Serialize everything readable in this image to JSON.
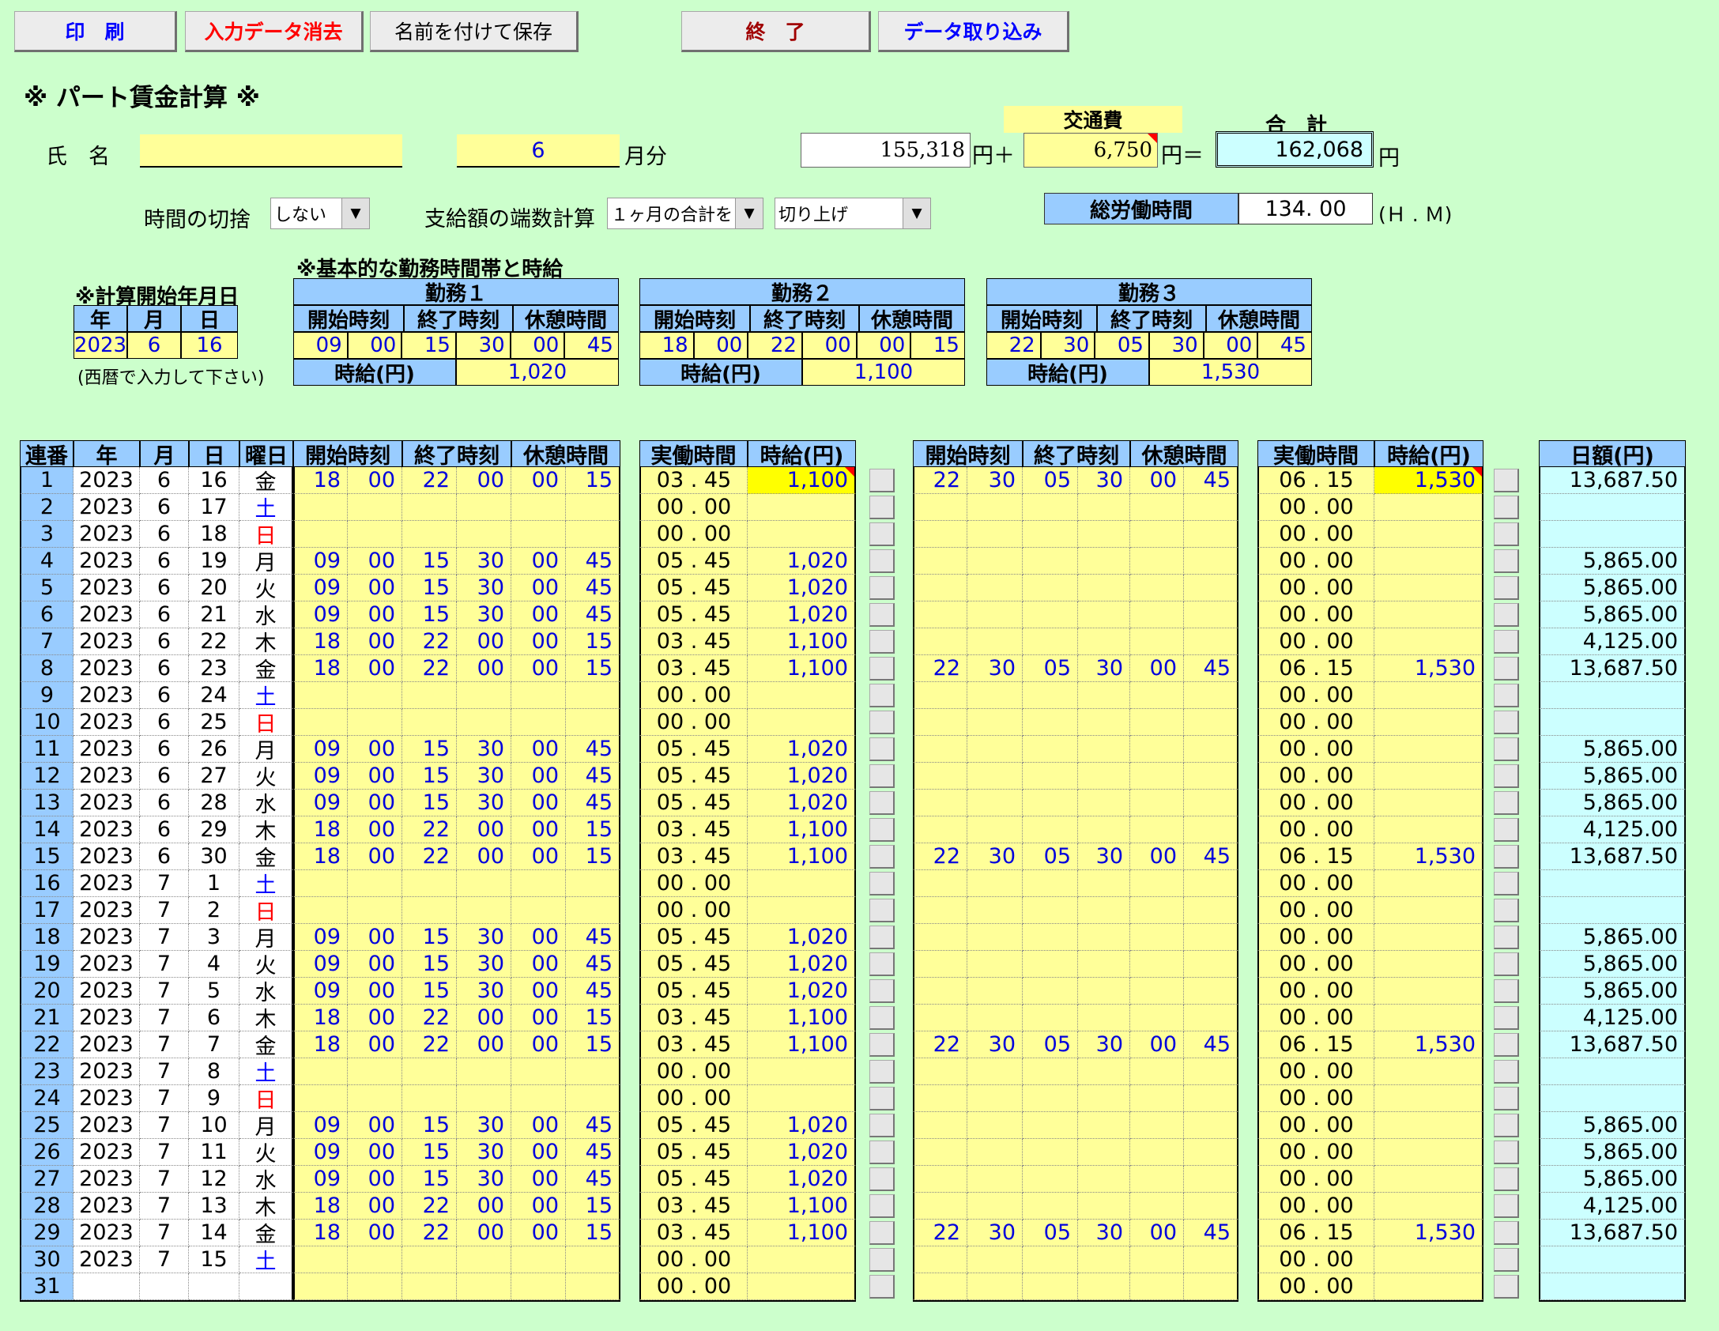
{
  "toolbar": {
    "print": "印　刷",
    "clear": "入力データ消去",
    "save_as": "名前を付けて保存",
    "exit": "終　了",
    "import": "データ取り込み"
  },
  "title": "※ パート賃金計算 ※",
  "name_row": {
    "name_label": "氏　名",
    "name_value": "",
    "month_value": "6",
    "month_suffix": "月分",
    "pay_value": "155,318",
    "yen_plus": "円＋",
    "transport_label": "交通費",
    "transport_value": "6,750",
    "yen_eq": "円＝",
    "total_label": "合　計",
    "total_value": "162,068",
    "yen": "円"
  },
  "options": {
    "rounding_label": "時間の切捨",
    "rounding_value": "しない",
    "pay_round_label": "支給額の端数計算",
    "pay_round_mode": "１ヶ月の合計を",
    "pay_round_value": "切り上げ",
    "total_hours_label": "総労働時間",
    "total_hours_value": "134. 00",
    "hm_label": "(Ｈ . Ｍ)"
  },
  "start": {
    "heading": "※計算開始年月日",
    "headers": [
      "年",
      "月",
      "日"
    ],
    "values": [
      "2023",
      "6",
      "16"
    ],
    "note": "(西暦で入力して下さい)"
  },
  "shift_ref": {
    "heading": "※基本的な勤務時間帯と時給",
    "col_headers": [
      "開始時刻",
      "終了時刻",
      "休憩時間"
    ],
    "wage_label": "時給(円)",
    "shifts": [
      {
        "name": "勤務１",
        "times": [
          "09",
          "00",
          "15",
          "30",
          "00",
          "45"
        ],
        "wage": "1,020"
      },
      {
        "name": "勤務２",
        "times": [
          "18",
          "00",
          "22",
          "00",
          "00",
          "15"
        ],
        "wage": "1,100"
      },
      {
        "name": "勤務３",
        "times": [
          "22",
          "30",
          "05",
          "30",
          "00",
          "45"
        ],
        "wage": "1,530"
      }
    ]
  },
  "table": {
    "headers": {
      "no": "連番",
      "year": "年",
      "month": "月",
      "day": "日",
      "dow": "曜日",
      "start": "開始時刻",
      "end": "終了時刻",
      "break": "休憩時間",
      "actual": "実働時間",
      "wage": "時給(円)",
      "daily": "日額(円)"
    },
    "rows": [
      [
        "1",
        "2023",
        "6",
        "16",
        "金",
        "18",
        "00",
        "22",
        "00",
        "00",
        "15",
        "03 . 45",
        "1,100",
        "22",
        "30",
        "05",
        "30",
        "00",
        "45",
        "06 . 15",
        "1,530",
        "13,687.50"
      ],
      [
        "2",
        "2023",
        "6",
        "17",
        "土",
        "",
        "",
        "",
        "",
        "",
        "",
        "00 . 00",
        "",
        "",
        "",
        "",
        "",
        "",
        "",
        "00 . 00",
        "",
        ""
      ],
      [
        "3",
        "2023",
        "6",
        "18",
        "日",
        "",
        "",
        "",
        "",
        "",
        "",
        "00 . 00",
        "",
        "",
        "",
        "",
        "",
        "",
        "",
        "00 . 00",
        "",
        ""
      ],
      [
        "4",
        "2023",
        "6",
        "19",
        "月",
        "09",
        "00",
        "15",
        "30",
        "00",
        "45",
        "05 . 45",
        "1,020",
        "",
        "",
        "",
        "",
        "",
        "",
        "00 . 00",
        "",
        "5,865.00"
      ],
      [
        "5",
        "2023",
        "6",
        "20",
        "火",
        "09",
        "00",
        "15",
        "30",
        "00",
        "45",
        "05 . 45",
        "1,020",
        "",
        "",
        "",
        "",
        "",
        "",
        "00 . 00",
        "",
        "5,865.00"
      ],
      [
        "6",
        "2023",
        "6",
        "21",
        "水",
        "09",
        "00",
        "15",
        "30",
        "00",
        "45",
        "05 . 45",
        "1,020",
        "",
        "",
        "",
        "",
        "",
        "",
        "00 . 00",
        "",
        "5,865.00"
      ],
      [
        "7",
        "2023",
        "6",
        "22",
        "木",
        "18",
        "00",
        "22",
        "00",
        "00",
        "15",
        "03 . 45",
        "1,100",
        "",
        "",
        "",
        "",
        "",
        "",
        "00 . 00",
        "",
        "4,125.00"
      ],
      [
        "8",
        "2023",
        "6",
        "23",
        "金",
        "18",
        "00",
        "22",
        "00",
        "00",
        "15",
        "03 . 45",
        "1,100",
        "22",
        "30",
        "05",
        "30",
        "00",
        "45",
        "06 . 15",
        "1,530",
        "13,687.50"
      ],
      [
        "9",
        "2023",
        "6",
        "24",
        "土",
        "",
        "",
        "",
        "",
        "",
        "",
        "00 . 00",
        "",
        "",
        "",
        "",
        "",
        "",
        "",
        "00 . 00",
        "",
        ""
      ],
      [
        "10",
        "2023",
        "6",
        "25",
        "日",
        "",
        "",
        "",
        "",
        "",
        "",
        "00 . 00",
        "",
        "",
        "",
        "",
        "",
        "",
        "",
        "00 . 00",
        "",
        ""
      ],
      [
        "11",
        "2023",
        "6",
        "26",
        "月",
        "09",
        "00",
        "15",
        "30",
        "00",
        "45",
        "05 . 45",
        "1,020",
        "",
        "",
        "",
        "",
        "",
        "",
        "00 . 00",
        "",
        "5,865.00"
      ],
      [
        "12",
        "2023",
        "6",
        "27",
        "火",
        "09",
        "00",
        "15",
        "30",
        "00",
        "45",
        "05 . 45",
        "1,020",
        "",
        "",
        "",
        "",
        "",
        "",
        "00 . 00",
        "",
        "5,865.00"
      ],
      [
        "13",
        "2023",
        "6",
        "28",
        "水",
        "09",
        "00",
        "15",
        "30",
        "00",
        "45",
        "05 . 45",
        "1,020",
        "",
        "",
        "",
        "",
        "",
        "",
        "00 . 00",
        "",
        "5,865.00"
      ],
      [
        "14",
        "2023",
        "6",
        "29",
        "木",
        "18",
        "00",
        "22",
        "00",
        "00",
        "15",
        "03 . 45",
        "1,100",
        "",
        "",
        "",
        "",
        "",
        "",
        "00 . 00",
        "",
        "4,125.00"
      ],
      [
        "15",
        "2023",
        "6",
        "30",
        "金",
        "18",
        "00",
        "22",
        "00",
        "00",
        "15",
        "03 . 45",
        "1,100",
        "22",
        "30",
        "05",
        "30",
        "00",
        "45",
        "06 . 15",
        "1,530",
        "13,687.50"
      ],
      [
        "16",
        "2023",
        "7",
        "1",
        "土",
        "",
        "",
        "",
        "",
        "",
        "",
        "00 . 00",
        "",
        "",
        "",
        "",
        "",
        "",
        "",
        "00 . 00",
        "",
        ""
      ],
      [
        "17",
        "2023",
        "7",
        "2",
        "日",
        "",
        "",
        "",
        "",
        "",
        "",
        "00 . 00",
        "",
        "",
        "",
        "",
        "",
        "",
        "",
        "00 . 00",
        "",
        ""
      ],
      [
        "18",
        "2023",
        "7",
        "3",
        "月",
        "09",
        "00",
        "15",
        "30",
        "00",
        "45",
        "05 . 45",
        "1,020",
        "",
        "",
        "",
        "",
        "",
        "",
        "00 . 00",
        "",
        "5,865.00"
      ],
      [
        "19",
        "2023",
        "7",
        "4",
        "火",
        "09",
        "00",
        "15",
        "30",
        "00",
        "45",
        "05 . 45",
        "1,020",
        "",
        "",
        "",
        "",
        "",
        "",
        "00 . 00",
        "",
        "5,865.00"
      ],
      [
        "20",
        "2023",
        "7",
        "5",
        "水",
        "09",
        "00",
        "15",
        "30",
        "00",
        "45",
        "05 . 45",
        "1,020",
        "",
        "",
        "",
        "",
        "",
        "",
        "00 . 00",
        "",
        "5,865.00"
      ],
      [
        "21",
        "2023",
        "7",
        "6",
        "木",
        "18",
        "00",
        "22",
        "00",
        "00",
        "15",
        "03 . 45",
        "1,100",
        "",
        "",
        "",
        "",
        "",
        "",
        "00 . 00",
        "",
        "4,125.00"
      ],
      [
        "22",
        "2023",
        "7",
        "7",
        "金",
        "18",
        "00",
        "22",
        "00",
        "00",
        "15",
        "03 . 45",
        "1,100",
        "22",
        "30",
        "05",
        "30",
        "00",
        "45",
        "06 . 15",
        "1,530",
        "13,687.50"
      ],
      [
        "23",
        "2023",
        "7",
        "8",
        "土",
        "",
        "",
        "",
        "",
        "",
        "",
        "00 . 00",
        "",
        "",
        "",
        "",
        "",
        "",
        "",
        "00 . 00",
        "",
        ""
      ],
      [
        "24",
        "2023",
        "7",
        "9",
        "日",
        "",
        "",
        "",
        "",
        "",
        "",
        "00 . 00",
        "",
        "",
        "",
        "",
        "",
        "",
        "",
        "00 . 00",
        "",
        ""
      ],
      [
        "25",
        "2023",
        "7",
        "10",
        "月",
        "09",
        "00",
        "15",
        "30",
        "00",
        "45",
        "05 . 45",
        "1,020",
        "",
        "",
        "",
        "",
        "",
        "",
        "00 . 00",
        "",
        "5,865.00"
      ],
      [
        "26",
        "2023",
        "7",
        "11",
        "火",
        "09",
        "00",
        "15",
        "30",
        "00",
        "45",
        "05 . 45",
        "1,020",
        "",
        "",
        "",
        "",
        "",
        "",
        "00 . 00",
        "",
        "5,865.00"
      ],
      [
        "27",
        "2023",
        "7",
        "12",
        "水",
        "09",
        "00",
        "15",
        "30",
        "00",
        "45",
        "05 . 45",
        "1,020",
        "",
        "",
        "",
        "",
        "",
        "",
        "00 . 00",
        "",
        "5,865.00"
      ],
      [
        "28",
        "2023",
        "7",
        "13",
        "木",
        "18",
        "00",
        "22",
        "00",
        "00",
        "15",
        "03 . 45",
        "1,100",
        "",
        "",
        "",
        "",
        "",
        "",
        "00 . 00",
        "",
        "4,125.00"
      ],
      [
        "29",
        "2023",
        "7",
        "14",
        "金",
        "18",
        "00",
        "22",
        "00",
        "00",
        "15",
        "03 . 45",
        "1,100",
        "22",
        "30",
        "05",
        "30",
        "00",
        "45",
        "06 . 15",
        "1,530",
        "13,687.50"
      ],
      [
        "30",
        "2023",
        "7",
        "15",
        "土",
        "",
        "",
        "",
        "",
        "",
        "",
        "00 . 00",
        "",
        "",
        "",
        "",
        "",
        "",
        "",
        "00 . 00",
        "",
        ""
      ],
      [
        "31",
        "",
        "",
        "",
        "",
        "",
        "",
        "",
        "",
        "",
        "",
        "00 . 00",
        "",
        "",
        "",
        "",
        "",
        "",
        "",
        "00 . 00",
        "",
        ""
      ]
    ]
  },
  "colors": {
    "bg": "#ccffcc",
    "yellow": "#ffff99",
    "header_blue": "#99ccff",
    "daily_cyan": "#ccffff",
    "input_blue": "#0000dd",
    "sat_blue": "#0000ff",
    "sun_red": "#ff0000"
  }
}
